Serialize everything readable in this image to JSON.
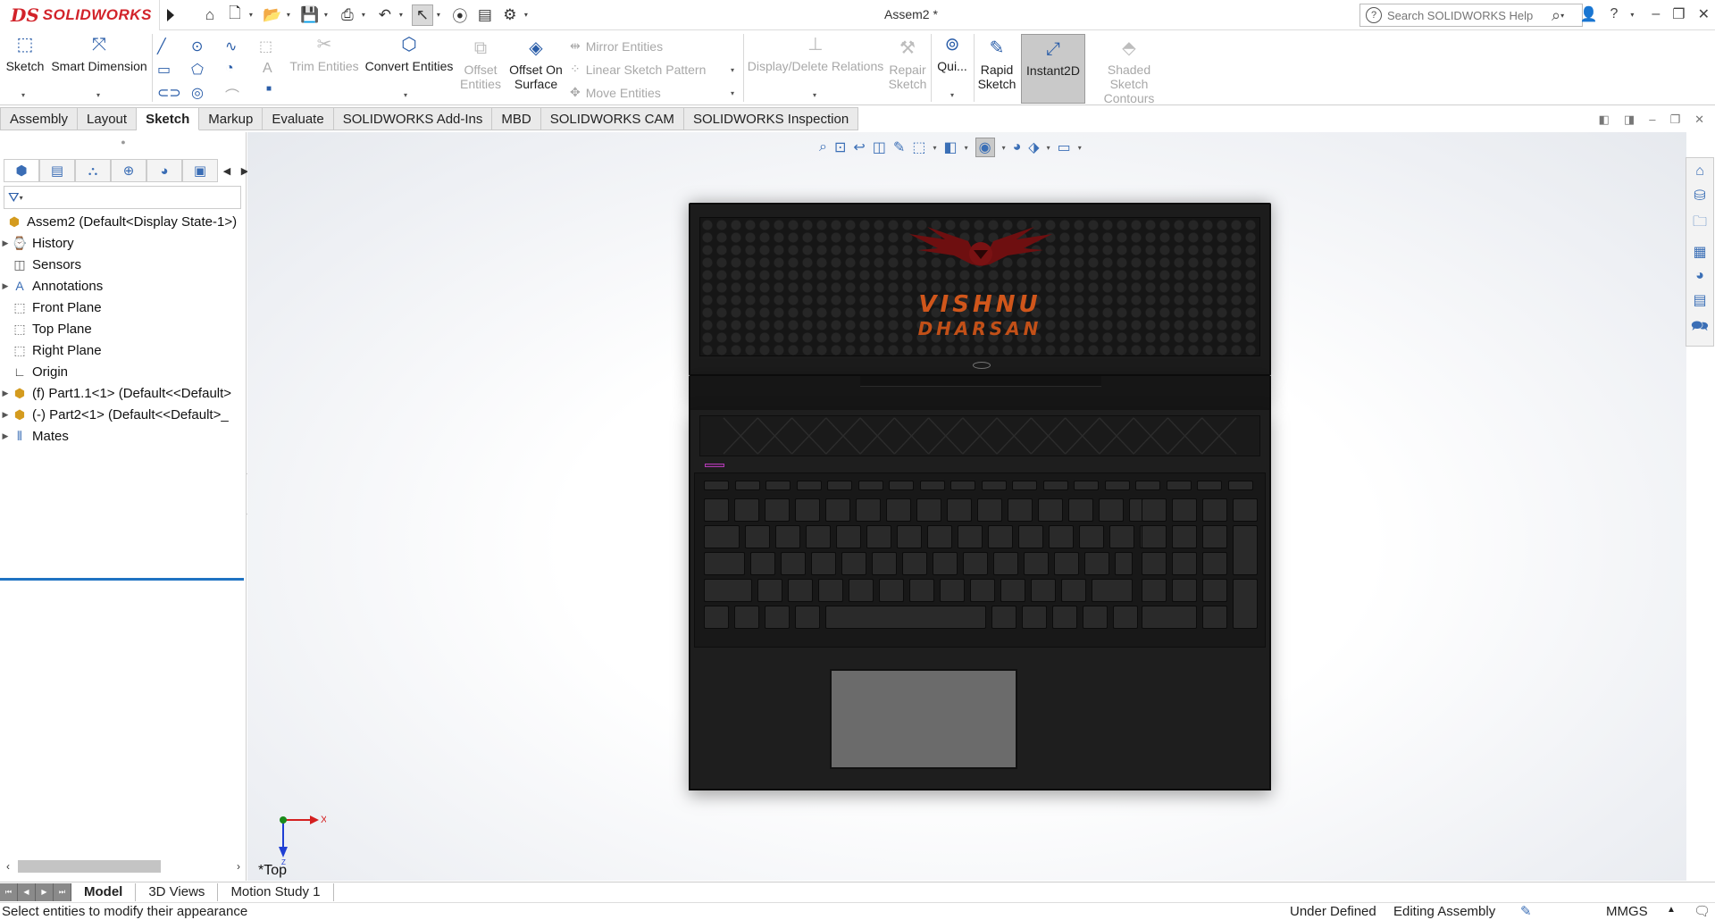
{
  "app": {
    "brand_mark": "DS",
    "brand_name": "SOLIDWORKS",
    "doc_title": "Assem2 *"
  },
  "search": {
    "placeholder": "Search SOLIDWORKS Help"
  },
  "toolbar": {
    "sketch": "Sketch",
    "smart_dimension": "Smart Dimension",
    "trim_entities": "Trim Entities",
    "convert_entities": "Convert Entities",
    "offset_entities_1": "Offset",
    "offset_entities_2": "Entities",
    "offset_on_surface_1": "Offset On",
    "offset_on_surface_2": "Surface",
    "mirror_entities": "Mirror Entities",
    "linear_sketch_pattern": "Linear Sketch Pattern",
    "move_entities": "Move Entities",
    "display_delete_relations": "Display/Delete Relations",
    "repair_sketch_1": "Repair",
    "repair_sketch_2": "Sketch",
    "quick_snaps": "Qui...",
    "rapid_sketch_1": "Rapid",
    "rapid_sketch_2": "Sketch",
    "instant2d": "Instant2D",
    "shaded_contours_1": "Shaded Sketch",
    "shaded_contours_2": "Contours"
  },
  "tabs": [
    {
      "label": "Assembly"
    },
    {
      "label": "Layout"
    },
    {
      "label": "Sketch"
    },
    {
      "label": "Markup"
    },
    {
      "label": "Evaluate"
    },
    {
      "label": "SOLIDWORKS Add-Ins"
    },
    {
      "label": "MBD"
    },
    {
      "label": "SOLIDWORKS CAM"
    },
    {
      "label": "SOLIDWORKS Inspection"
    }
  ],
  "active_tab": "Sketch",
  "tree": {
    "root": "Assem2  (Default<Display State-1>)",
    "items": [
      {
        "label": "History",
        "icon": "history-icon"
      },
      {
        "label": "Sensors",
        "icon": "sensors-icon"
      },
      {
        "label": "Annotations",
        "icon": "annotations-icon"
      },
      {
        "label": "Front Plane",
        "icon": "plane-icon"
      },
      {
        "label": "Top Plane",
        "icon": "plane-icon"
      },
      {
        "label": "Right Plane",
        "icon": "plane-icon"
      },
      {
        "label": "Origin",
        "icon": "origin-icon"
      },
      {
        "label": "(f) Part1.1<1> (Default<<Default>",
        "icon": "part-icon"
      },
      {
        "label": "(-) Part2<1> (Default<<Default>_",
        "icon": "part-icon"
      },
      {
        "label": "Mates",
        "icon": "mates-icon"
      }
    ]
  },
  "model": {
    "brand_line1": "VISHNU",
    "brand_line2": "DHARSAN"
  },
  "viewport": {
    "view_name": "*Top",
    "axis_x": "X",
    "axis_z": "Z"
  },
  "bottom_tabs": [
    {
      "label": "Model"
    },
    {
      "label": "3D Views"
    },
    {
      "label": "Motion Study 1"
    }
  ],
  "status": {
    "message": "Select entities to modify their appearance",
    "definition": "Under Defined",
    "mode": "Editing Assembly",
    "units": "MMGS"
  },
  "colors": {
    "brand_red": "#d2232a",
    "accent_blue": "#1f73c2",
    "brand_orange": "#d0561b"
  }
}
